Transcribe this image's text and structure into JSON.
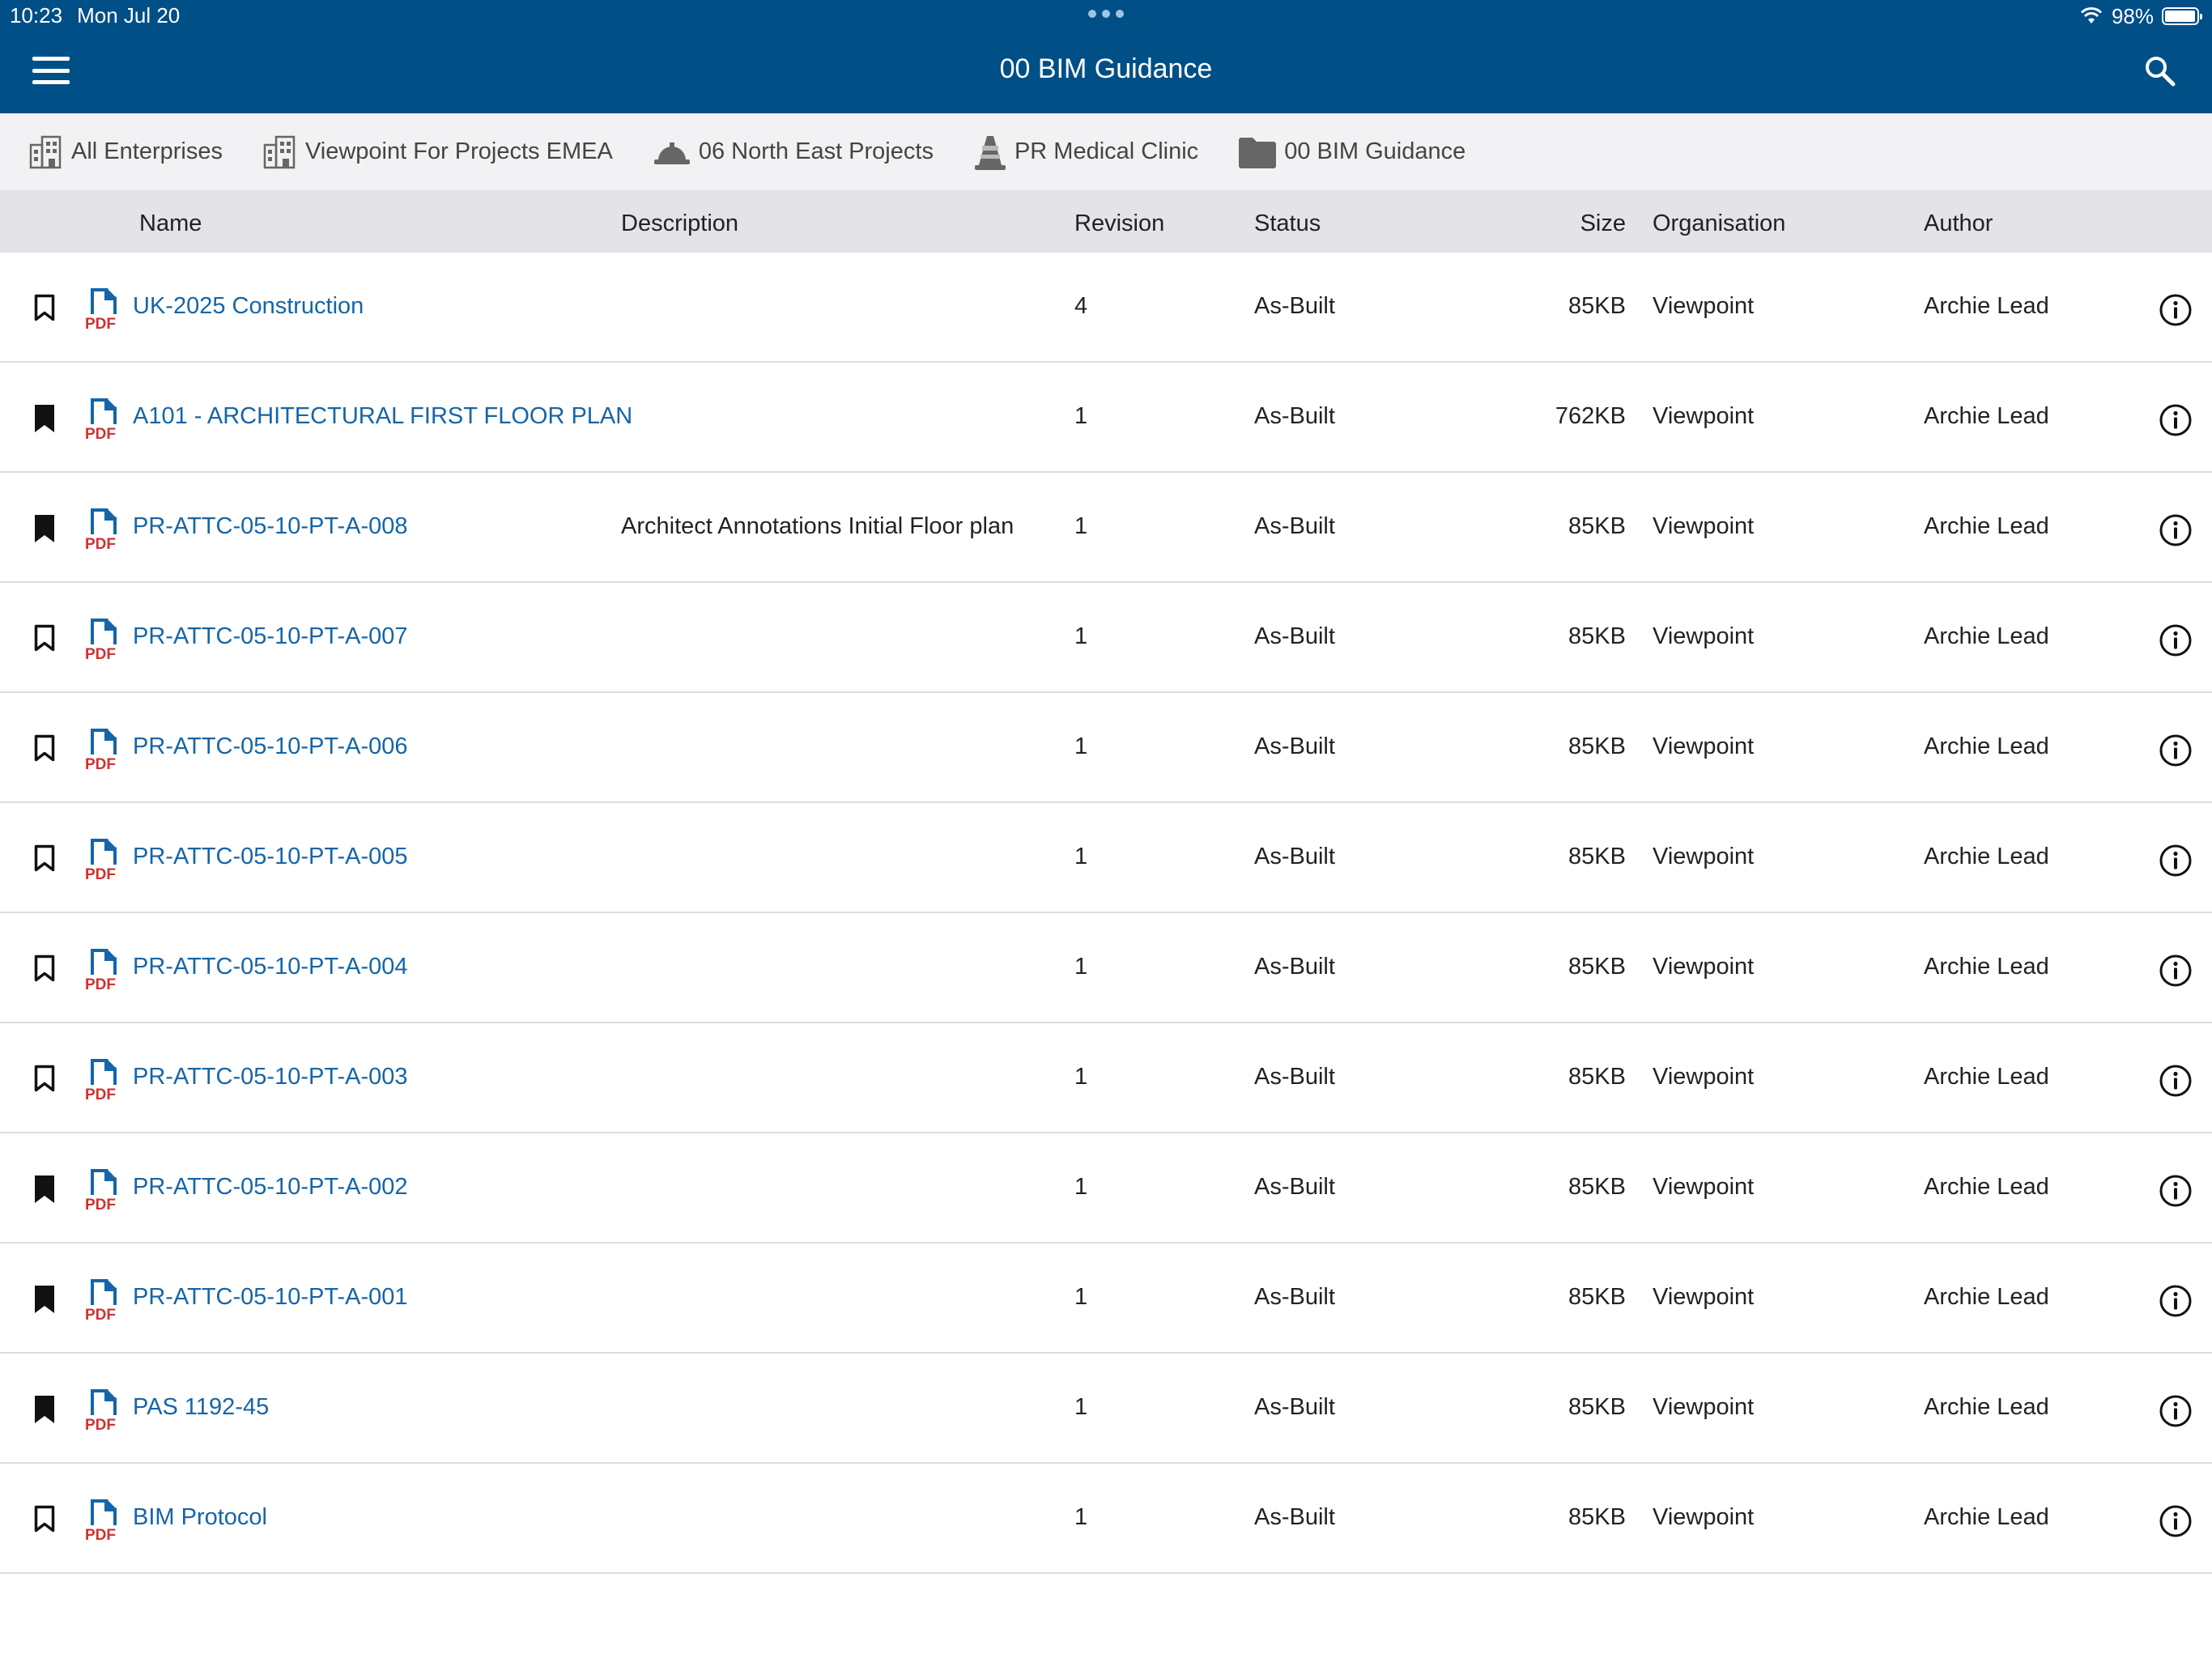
{
  "status_bar": {
    "time": "10:23",
    "date": "Mon Jul 20",
    "battery": "98%",
    "battery_level": 0.98
  },
  "nav": {
    "title": "00 BIM Guidance",
    "menu_icon": "hamburger-menu-icon",
    "search_icon": "search-icon"
  },
  "breadcrumb": [
    {
      "label": "All Enterprises",
      "icon": "building-icon"
    },
    {
      "label": "Viewpoint For Projects EMEA",
      "icon": "building-icon"
    },
    {
      "label": "06 North East Projects",
      "icon": "hard-hat-icon"
    },
    {
      "label": "PR Medical Clinic",
      "icon": "traffic-cone-icon"
    },
    {
      "label": "00 BIM Guidance",
      "icon": "folder-icon"
    }
  ],
  "columns": {
    "name": "Name",
    "description": "Description",
    "revision": "Revision",
    "status": "Status",
    "size": "Size",
    "organisation": "Organisation",
    "author": "Author"
  },
  "rows": [
    {
      "bookmarked": false,
      "name": "UK-2025 Construction",
      "description": "",
      "revision": "4",
      "status": "As-Built",
      "size": "85KB",
      "organisation": "Viewpoint",
      "author": "Archie Lead"
    },
    {
      "bookmarked": true,
      "name": "A101 - ARCHITECTURAL FIRST FLOOR PLAN",
      "description": "",
      "revision": "1",
      "status": "As-Built",
      "size": "762KB",
      "organisation": "Viewpoint",
      "author": "Archie Lead"
    },
    {
      "bookmarked": true,
      "name": "PR-ATTC-05-10-PT-A-008",
      "description": "Architect Annotations Initial Floor plan",
      "revision": "1",
      "status": "As-Built",
      "size": "85KB",
      "organisation": "Viewpoint",
      "author": "Archie Lead"
    },
    {
      "bookmarked": false,
      "name": "PR-ATTC-05-10-PT-A-007",
      "description": "",
      "revision": "1",
      "status": "As-Built",
      "size": "85KB",
      "organisation": "Viewpoint",
      "author": "Archie Lead"
    },
    {
      "bookmarked": false,
      "name": "PR-ATTC-05-10-PT-A-006",
      "description": "",
      "revision": "1",
      "status": "As-Built",
      "size": "85KB",
      "organisation": "Viewpoint",
      "author": "Archie Lead"
    },
    {
      "bookmarked": false,
      "name": "PR-ATTC-05-10-PT-A-005",
      "description": "",
      "revision": "1",
      "status": "As-Built",
      "size": "85KB",
      "organisation": "Viewpoint",
      "author": "Archie Lead"
    },
    {
      "bookmarked": false,
      "name": "PR-ATTC-05-10-PT-A-004",
      "description": "",
      "revision": "1",
      "status": "As-Built",
      "size": "85KB",
      "organisation": "Viewpoint",
      "author": "Archie Lead"
    },
    {
      "bookmarked": false,
      "name": "PR-ATTC-05-10-PT-A-003",
      "description": "",
      "revision": "1",
      "status": "As-Built",
      "size": "85KB",
      "organisation": "Viewpoint",
      "author": "Archie Lead"
    },
    {
      "bookmarked": true,
      "name": "PR-ATTC-05-10-PT-A-002",
      "description": "",
      "revision": "1",
      "status": "As-Built",
      "size": "85KB",
      "organisation": "Viewpoint",
      "author": "Archie Lead"
    },
    {
      "bookmarked": true,
      "name": "PR-ATTC-05-10-PT-A-001",
      "description": "",
      "revision": "1",
      "status": "As-Built",
      "size": "85KB",
      "organisation": "Viewpoint",
      "author": "Archie Lead"
    },
    {
      "bookmarked": true,
      "name": "PAS 1192-45",
      "description": "",
      "revision": "1",
      "status": "As-Built",
      "size": "85KB",
      "organisation": "Viewpoint",
      "author": "Archie Lead"
    },
    {
      "bookmarked": false,
      "name": "BIM Protocol",
      "description": "",
      "revision": "1",
      "status": "As-Built",
      "size": "85KB",
      "organisation": "Viewpoint",
      "author": "Archie Lead"
    }
  ],
  "file_type_label": "PDF",
  "colors": {
    "nav_bar": "#004f87",
    "link": "#1565a8",
    "pdf_icon_blue": "#1565a8",
    "pdf_label_red": "#d32f2f",
    "header_bg": "#e3e3e8",
    "breadcrumb_bg": "#f2f2f4"
  }
}
